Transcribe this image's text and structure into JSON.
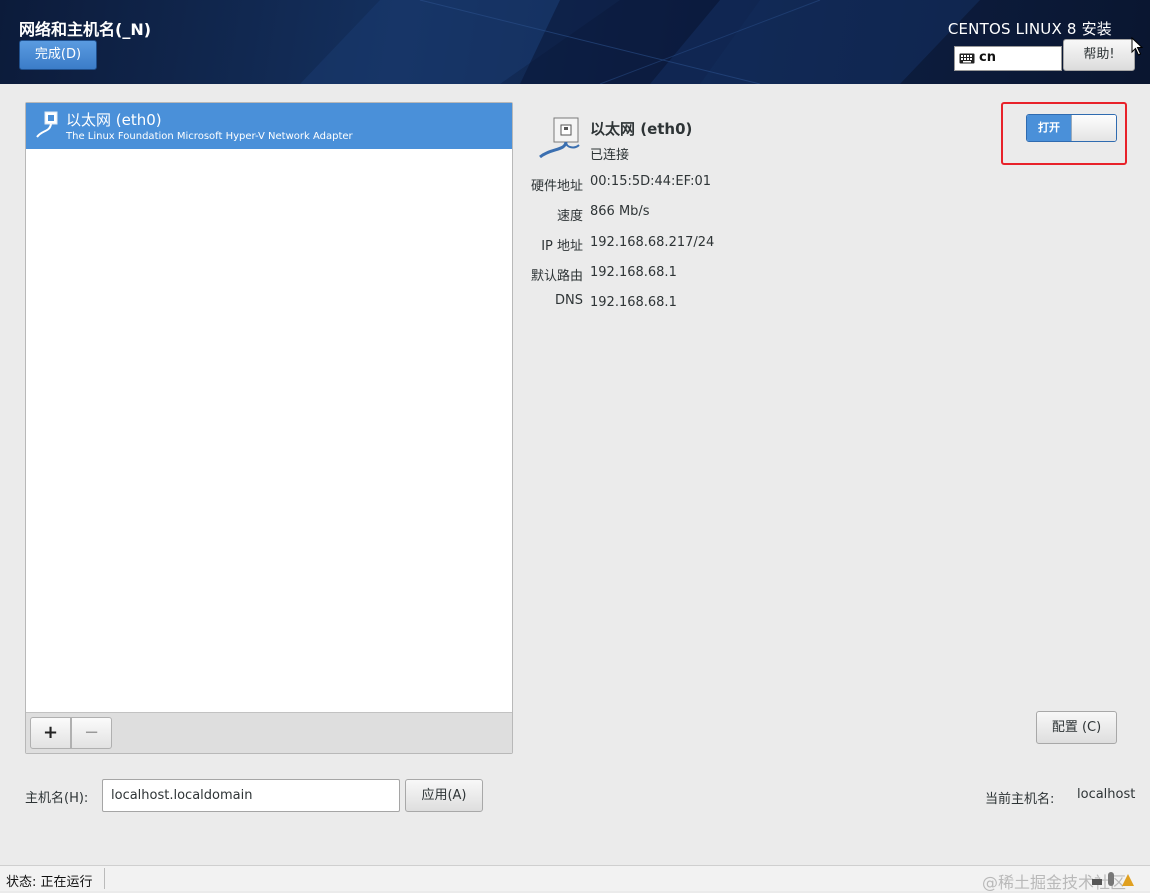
{
  "header": {
    "spoke_title": "网络和主机名(_N)",
    "done_label": "完成(D)",
    "distro_title": "CENTOS LINUX 8 安装",
    "keyboard_layout": "cn",
    "help_label": "帮助!"
  },
  "devices": [
    {
      "name": "以太网 (eth0)",
      "description": "The Linux Foundation Microsoft Hyper-V Network Adapter",
      "selected": true
    }
  ],
  "list_toolbar": {
    "add_label": "+",
    "remove_label": "−"
  },
  "details": {
    "name": "以太网 (eth0)",
    "status": "已连接",
    "fields": [
      {
        "key": "硬件地址",
        "value": "00:15:5D:44:EF:01"
      },
      {
        "key": "速度",
        "value": "866 Mb/s"
      },
      {
        "key": "IP 地址",
        "value": "192.168.68.217/24"
      },
      {
        "key": "默认路由",
        "value": "192.168.68.1"
      },
      {
        "key": "DNS",
        "value": "192.168.68.1"
      }
    ],
    "switch_label": "打开",
    "switch_on": true,
    "config_label": "配置 (C)"
  },
  "hostname": {
    "label": "主机名(H):",
    "value": "localhost.localdomain",
    "apply_label": "应用(A)",
    "current_label": "当前主机名:",
    "current_value": "localhost"
  },
  "statusbar": {
    "status_text": "状态: 正在运行",
    "watermark": "@稀土掘金技术社区"
  },
  "colors": {
    "accent": "#4a90d9",
    "highlight_frame": "#e8222a",
    "header_bg": "#0e2148"
  }
}
